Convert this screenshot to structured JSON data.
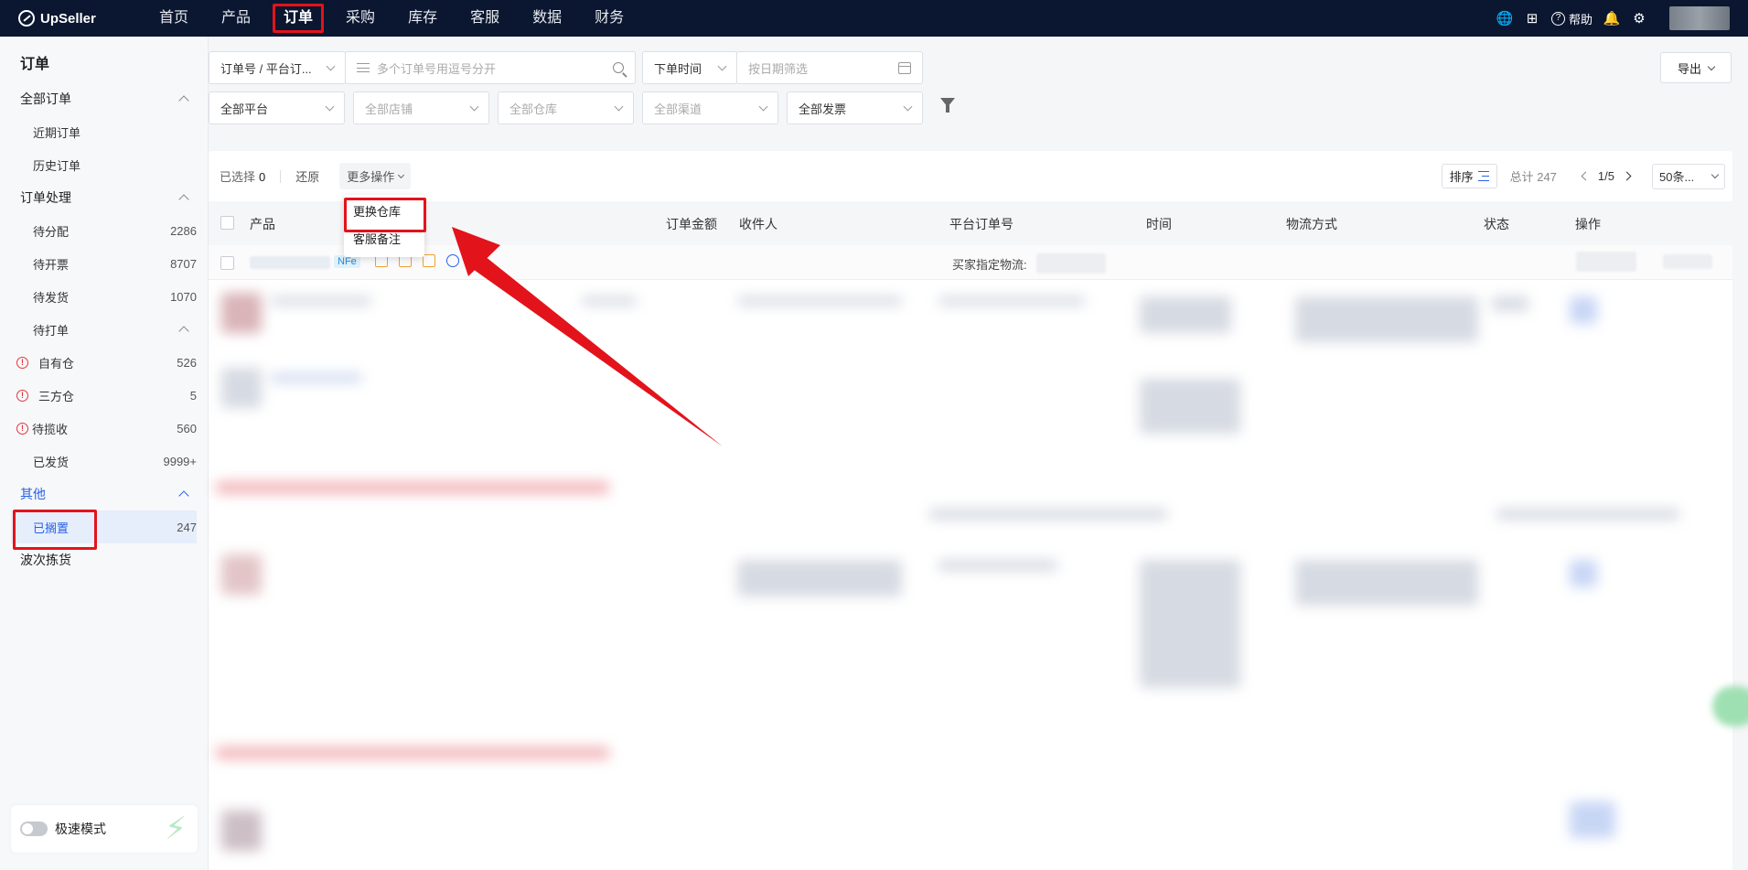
{
  "topbar": {
    "brand": "UpSeller",
    "nav": [
      "首页",
      "产品",
      "订单",
      "采购",
      "库存",
      "客服",
      "数据",
      "财务"
    ],
    "active_nav": "订单",
    "help_label": "帮助"
  },
  "sidebar": {
    "title": "订单",
    "group_all": "全部订单",
    "recent": "近期订单",
    "history": "历史订单",
    "group_process": "订单处理",
    "to_assign": {
      "label": "待分配",
      "count": "2286"
    },
    "to_invoice": {
      "label": "待开票",
      "count": "8707"
    },
    "to_ship": {
      "label": "待发货",
      "count": "1070"
    },
    "group_print": "待打单",
    "own_wh": {
      "label": "自有仓",
      "count": "526"
    },
    "third_wh": {
      "label": "三方仓",
      "count": "5"
    },
    "to_collect": {
      "label": "待揽收",
      "count": "560"
    },
    "shipped": {
      "label": "已发货",
      "count": "9999+"
    },
    "group_other": "其他",
    "on_hold": {
      "label": "已搁置",
      "count": "247"
    },
    "wave_pick": "波次拣货",
    "speed_mode": "极速模式"
  },
  "filters": {
    "order_type": "订单号 / 平台订...",
    "order_search_placeholder": "多个订单号用逗号分开",
    "time_type": "下单时间",
    "date_placeholder": "按日期筛选",
    "platform": "全部平台",
    "shop": "全部店铺",
    "warehouse": "全部仓库",
    "channel": "全部渠道",
    "invoice": "全部发票",
    "export": "导出"
  },
  "toolbar": {
    "selected_label": "已选择",
    "selected_count": "0",
    "restore": "还原",
    "more_actions": "更多操作",
    "sort": "排序",
    "total": "总计 247",
    "page": "1/5",
    "page_size": "50条..."
  },
  "dropdown": {
    "items": [
      "更换仓库",
      "客服备注"
    ]
  },
  "table": {
    "headers": [
      "产品",
      "订单金额",
      "收件人",
      "平台订单号",
      "时间",
      "物流方式",
      "状态",
      "操作"
    ],
    "nfe_tag": "NFe",
    "buyer_logistics": "买家指定物流:"
  },
  "colors": {
    "accent": "#2a61e8",
    "highlight": "#e3131b",
    "topbar": "#0b1730"
  }
}
